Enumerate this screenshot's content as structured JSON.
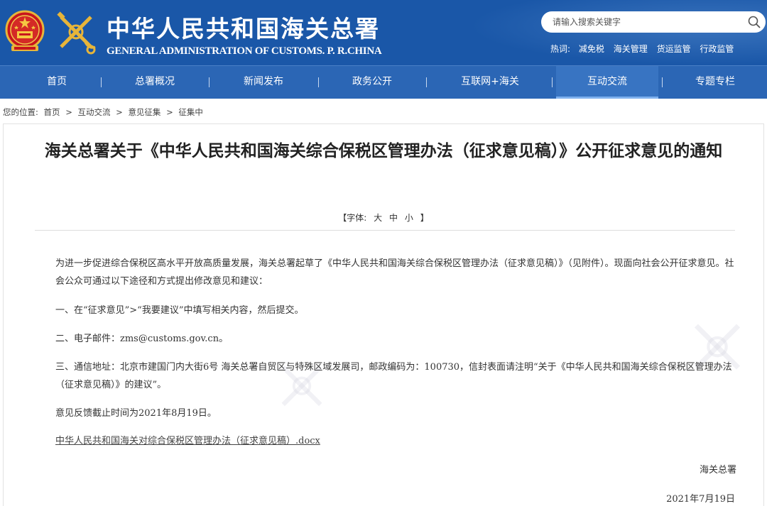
{
  "header": {
    "title_cn": "中华人民共和国海关总署",
    "title_en": "GENERAL ADMINISTRATION OF CUSTOMS. P. R.CHINA",
    "search_placeholder": "请输入搜索关键字",
    "hot_label": "热词:",
    "hot_words": [
      "减免税",
      "海关管理",
      "货运监管",
      "行政监管"
    ]
  },
  "nav": {
    "items": [
      "首页",
      "总署概况",
      "新闻发布",
      "政务公开",
      "互联网+海关",
      "互动交流",
      "专题专栏"
    ],
    "active": "互动交流"
  },
  "breadcrumb": {
    "prefix": "您的位置:",
    "items": [
      "首页",
      "互动交流",
      "意见征集",
      "征集中"
    ],
    "sep": ">"
  },
  "article": {
    "title": "海关总署关于《中华人民共和国海关综合保税区管理办法（征求意见稿）》公开征求意见的通知",
    "fontsize": {
      "open": "【字体:",
      "large": "大",
      "medium": "中",
      "small": "小",
      "close": "】"
    },
    "paragraphs": [
      "为进一步促进综合保税区高水平开放高质量发展，海关总署起草了《中华人民共和国海关综合保税区管理办法（征求意见稿）》（见附件）。现面向社会公开征求意见。社会公众可通过以下途径和方式提出修改意见和建议：",
      "一、在“征求意见”>“我要建议”中填写相关内容，然后提交。",
      "二、电子邮件：zms@customs.gov.cn。",
      "三、通信地址：北京市建国门内大街6号 海关总署自贸区与特殊区域发展司，邮政编码为：100730，信封表面请注明“关于《中华人民共和国海关综合保税区管理办法（征求意见稿）》的建议”。",
      "意见反馈截止时间为2021年8月19日。"
    ],
    "attachment": "中华人民共和国海关对综合保税区管理办法（征求意见稿）.docx",
    "signature": "海关总署",
    "date": "2021年7月19日"
  },
  "colors": {
    "header_bg": "#1a57a8",
    "nav_bg": "#2b66b5",
    "nav_active": "#3874c2"
  }
}
